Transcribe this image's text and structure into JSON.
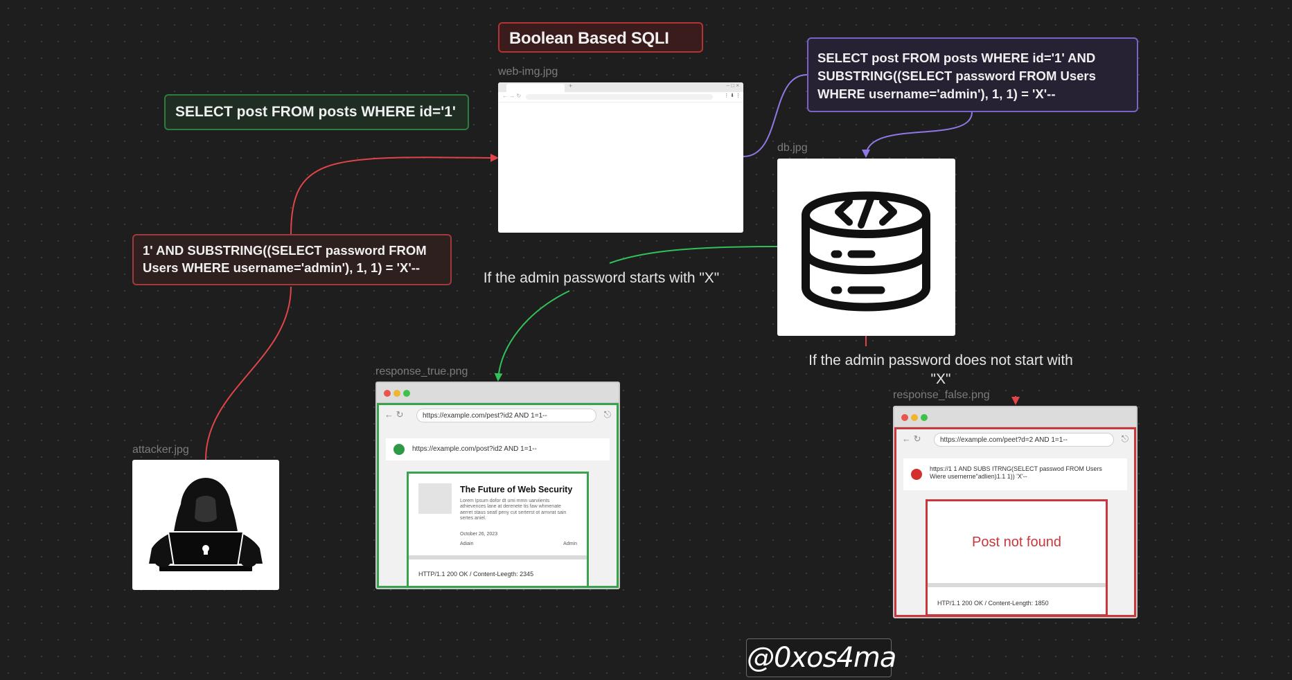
{
  "title": "Boolean Based SQLI",
  "cards": {
    "normal_query": "SELECT post FROM posts WHERE id='1'",
    "injected_query": "SELECT post FROM posts WHERE id='1' AND\nSUBSTRING((SELECT password FROM Users\nWHERE username='admin'), 1, 1) = 'X'--",
    "payload": "1' AND SUBSTRING((SELECT password FROM\nUsers WHERE username='admin'), 1, 1) = 'X'--"
  },
  "edge_labels": {
    "true_branch": "If the admin password starts with \"X\"",
    "false_branch": "If the admin password does not start with\n\"X\""
  },
  "images": {
    "web": {
      "label": "web-img.jpg",
      "tab_new": "+",
      "window_controls": "–  □  ×",
      "addr_icons": "⋮ ⬇ ⋮"
    },
    "db": {
      "label": "db.jpg",
      "code_glyph": "</>"
    },
    "attacker": {
      "label": "attacker.jpg"
    },
    "response_true": {
      "label": "response_true.png",
      "url": "https://example.com/pest?id2 AND 1=1--",
      "status_text": "https://example.com/post?id2 AND 1=1--",
      "article_title": "The Future of Web Security",
      "article_body": "Lorem Ipsum dofor dt umi mmn uarviients athievences lane at derenete tis faw whmenate aerret staus seatl peny cut serterst ot amvrat sain sertes aniel.",
      "article_date": "October 26, 2023",
      "author_left": "Adiain",
      "author_right": "Admin",
      "footer": "HTTP/1.1 200 OK / Content-Leegth: 2345"
    },
    "response_false": {
      "label": "response_false.png",
      "url": "https://example.com/peet?d=2 AND 1=1--",
      "status_text": "https://1 1  AND SUBS ITRNG(SELECT passwod FROM Users\nWiere usernerne\"adlien)1.1 1)) 'X'--",
      "message": "Post not found",
      "footer": "HTP/1.1 200 OK / Content-Length: 1850"
    }
  },
  "signature": "@0xos4ma",
  "colors": {
    "green": "#32c25a",
    "red": "#e0454a",
    "purple": "#9277e6"
  }
}
